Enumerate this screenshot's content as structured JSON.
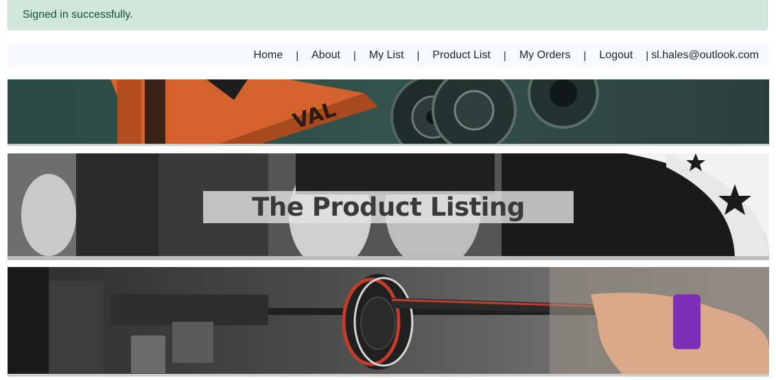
{
  "alert": {
    "message": "Signed in successfully."
  },
  "nav": {
    "items": [
      {
        "label": "Home"
      },
      {
        "label": "About"
      },
      {
        "label": "My List"
      },
      {
        "label": "Product List"
      },
      {
        "label": "My Orders"
      },
      {
        "label": "Logout"
      }
    ],
    "separator": "|",
    "user_email": "sl.hales@outlook.com"
  },
  "hero": {
    "title": "The Product Listing"
  },
  "colors": {
    "alert_bg": "#d1e7dd",
    "alert_text": "#0f5132",
    "navbar_bg": "#f8f9fa",
    "text": "#212529"
  }
}
